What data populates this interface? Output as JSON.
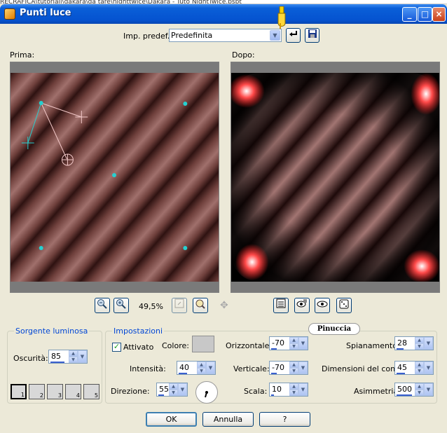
{
  "background_path": "RECRAFICA\\tutoriali\\dakara\\da tare\\nighttwice\\Dakara - Tuto NightTwice.pspt",
  "window": {
    "title": "Punti luce"
  },
  "preset": {
    "label": "Imp. predef.:",
    "value": "Predefinita"
  },
  "panels": {
    "before": "Prima:",
    "after": "Dopo:"
  },
  "zoom": {
    "value": "49,5%"
  },
  "light_source": {
    "group_title": "Sorgente luminosa",
    "darkness_label": "Oscurità:",
    "darkness_value": "85",
    "buttons": [
      "1",
      "2",
      "3",
      "4",
      "5"
    ]
  },
  "settings": {
    "group_title": "Impostazioni",
    "enabled_label": "Attivato",
    "color_label": "Colore:",
    "color_value": "#c8c8c8",
    "intensity_label": "Intensità:",
    "intensity_value": "40",
    "direction_label": "Direzione:",
    "direction_value": "55",
    "horizontal_label": "Orizzontale:",
    "horizontal_value": "-70",
    "vertical_label": "Verticale:",
    "vertical_value": "-70",
    "scale_label": "Scala:",
    "scale_value": "10",
    "spread_label": "Spianamento:",
    "spread_value": "28",
    "cone_label": "Dimensioni del cono:",
    "cone_value": "45",
    "asymmetry_label": "Asimmetria:",
    "asymmetry_value": "500"
  },
  "watermark": "Pinuccia",
  "footer": {
    "ok": "OK",
    "cancel": "Annulla",
    "help": "?"
  },
  "colors": {
    "title_blue": "#0553d0",
    "stripe_light": "#a0706c",
    "stripe_dark": "#2e1211",
    "marker": "#26d0d0"
  }
}
